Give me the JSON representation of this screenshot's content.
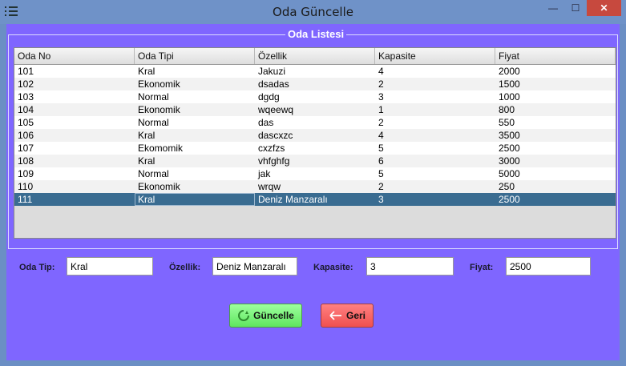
{
  "window": {
    "title": "Oda Güncelle",
    "minimize_glyph": "—",
    "maximize_glyph": "☐",
    "close_glyph": "✕"
  },
  "panel": {
    "legend": "Oda Listesi"
  },
  "table": {
    "headers": [
      "Oda No",
      "Oda Tipi",
      "Özellik",
      "Kapasite",
      "Fiyat"
    ],
    "rows": [
      [
        "101",
        "Kral",
        "Jakuzi",
        "4",
        "2000"
      ],
      [
        "102",
        "Ekonomik",
        "dsadas",
        "2",
        "1500"
      ],
      [
        "103",
        "Normal",
        "dgdg",
        "3",
        "1000"
      ],
      [
        "104",
        "Ekonomik",
        "wqeewq",
        "1",
        "800"
      ],
      [
        "105",
        "Normal",
        "das",
        "2",
        "550"
      ],
      [
        "106",
        "Kral",
        "dascxzc",
        "4",
        "3500"
      ],
      [
        "107",
        "Ekomomik",
        "cxzfzs",
        "5",
        "2500"
      ],
      [
        "108",
        "Kral",
        " vhfghfg",
        "6",
        "3000"
      ],
      [
        "109",
        "Normal",
        "jak",
        "5",
        "5000"
      ],
      [
        "110",
        "Ekonomik",
        "wrqw",
        "2",
        "250"
      ],
      [
        "111",
        "Kral",
        "Deniz Manzaralı",
        "3",
        "2500"
      ]
    ],
    "selected_row": 10
  },
  "form": {
    "oda_tip_label": "Oda Tip:",
    "oda_tip_value": "Kral",
    "ozellik_label": "Özellik:",
    "ozellik_value": "Deniz Manzaralı",
    "kapasite_label": "Kapasite:",
    "kapasite_value": "3",
    "fiyat_label": "Fiyat:",
    "fiyat_value": "2500"
  },
  "buttons": {
    "update_label": "Güncelle",
    "update_icon": "refresh-icon",
    "back_label": "Geri",
    "back_icon": "arrow-left-icon"
  },
  "colors": {
    "background": "#7f66ff",
    "selected_row": "#3a6c91",
    "update_button": "#66ee66",
    "back_button": "#f25a5a"
  }
}
